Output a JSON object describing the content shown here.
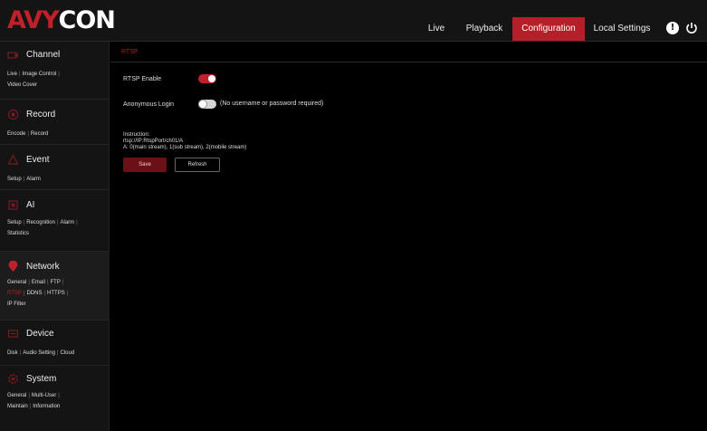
{
  "header": {
    "logo_part1": "AVY",
    "logo_part2": "CON",
    "nav": {
      "live": "Live",
      "playback": "Playback",
      "configuration": "Configuration",
      "local_settings": "Local Settings"
    },
    "info_icon": "!",
    "icons": [
      "info-icon",
      "power-icon"
    ]
  },
  "sidebar": {
    "channel": {
      "title": "Channel",
      "icon": "camera-icon",
      "links": [
        "Live",
        "Image Control",
        "Video Cover"
      ]
    },
    "record": {
      "title": "Record",
      "icon": "record-icon",
      "links": [
        "Encode",
        "Record"
      ]
    },
    "event": {
      "title": "Event",
      "icon": "event-icon",
      "links": [
        "Setup",
        "Alarm"
      ]
    },
    "ai": {
      "title": "AI",
      "icon": "ai-icon",
      "links": [
        "Setup",
        "Recognition",
        "Alarm",
        "Statistics"
      ]
    },
    "network": {
      "title": "Network",
      "icon": "network-icon",
      "links": [
        "General",
        "Email",
        "FTP",
        "RTSP",
        "DDNS",
        "HTTPS",
        "IP Filter"
      ],
      "current": "RTSP"
    },
    "device": {
      "title": "Device",
      "icon": "device-icon",
      "links": [
        "Disk",
        "Audio Setting",
        "Cloud"
      ]
    },
    "system": {
      "title": "System",
      "icon": "system-icon",
      "links": [
        "General",
        "Multi-User",
        "Maintain",
        "Information"
      ]
    }
  },
  "main": {
    "breadcrumb": "RTSP",
    "rtsp_enable_label": "RTSP Enable",
    "rtsp_enabled": true,
    "anonymous_login_label": "Anonymous Login",
    "anonymous_login_enabled": false,
    "anonymous_note": "(No username or password required)",
    "instruction_title": "Instruction:",
    "instruction_line1": "rtsp://IP:RtspPort/ch01/A",
    "instruction_line2": "A: 0(main stream), 1(sub stream), 2(mobile stream)",
    "save_label": "Save",
    "refresh_label": "Refresh"
  },
  "colors": {
    "accent": "#b51f29",
    "background": "#000000",
    "panel": "#141414"
  }
}
